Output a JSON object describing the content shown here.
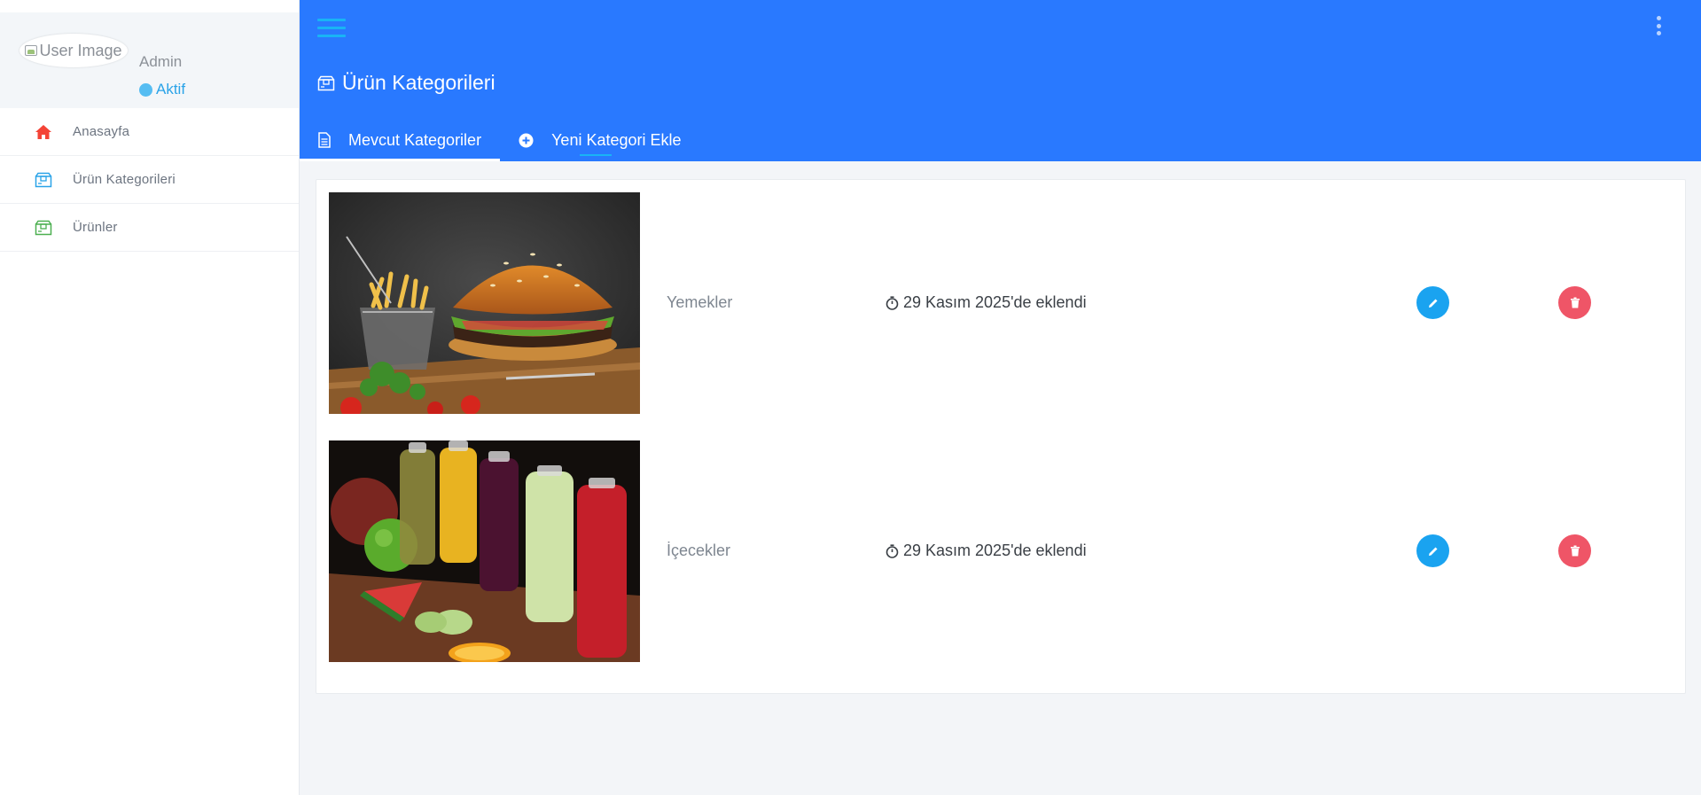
{
  "sidebar": {
    "avatar_alt": "User Image",
    "user_name": "Admin",
    "user_status": "Aktif",
    "items": [
      {
        "label": "Anasayfa",
        "icon": "home-icon",
        "color": "#f44336"
      },
      {
        "label": "Ürün Kategorileri",
        "icon": "box-icon",
        "color": "#2aa3e8"
      },
      {
        "label": "Ürünler",
        "icon": "box-icon",
        "color": "#4caf50"
      }
    ]
  },
  "header": {
    "title": "Ürün Kategorileri",
    "background": "#2979ff",
    "tabs": [
      {
        "label": "Mevcut Kategoriler",
        "icon": "document-icon",
        "active": true
      },
      {
        "label": "Yeni Kategori Ekle",
        "icon": "plus-circle-icon",
        "active": false
      }
    ]
  },
  "categories": [
    {
      "name": "Yemekler",
      "date": "29 Kasım 2025'de eklendi",
      "image": "burger-and-fries-photo"
    },
    {
      "name": "İçecekler",
      "date": "29 Kasım 2025'de eklendi",
      "image": "fruit-juice-bottles-photo"
    }
  ],
  "colors": {
    "edit_button": "#1aa3f0",
    "delete_button": "#ef5567"
  }
}
